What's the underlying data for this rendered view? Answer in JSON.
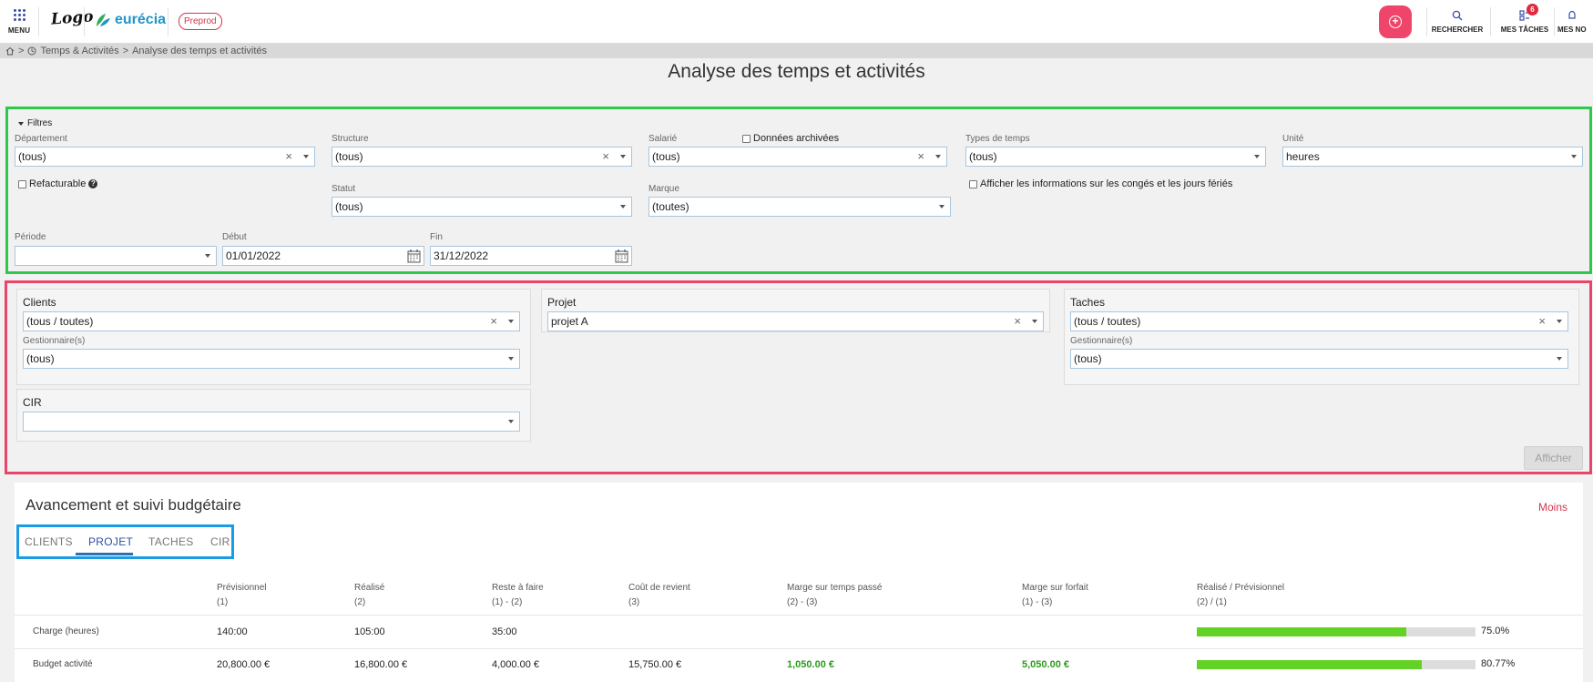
{
  "topbar": {
    "menu_label": "MENU",
    "logo_text": "Logo",
    "brand": "eurécia",
    "env_badge": "Preprod",
    "search_label": "RECHERCHER",
    "tasks_label": "MES TÂCHES",
    "tasks_count": "6",
    "notif_label": "MES NO",
    "accent_color": "#f0456a"
  },
  "breadcrumb": {
    "items": [
      "Temps & Activités",
      "Analyse des temps et activités"
    ],
    "separator": ">"
  },
  "page_title": "Analyse des temps et activités",
  "filters": {
    "toggle_label": "Filtres",
    "departement": {
      "label": "Département",
      "value": "(tous)"
    },
    "structure": {
      "label": "Structure",
      "value": "(tous)"
    },
    "salarie": {
      "label": "Salarié",
      "value": "(tous)"
    },
    "donnees_archivees": "Données archivées",
    "types_de_temps": {
      "label": "Types de temps",
      "value": "(tous)"
    },
    "unite": {
      "label": "Unité",
      "value": "heures"
    },
    "refacturable": "Refacturable",
    "statut": {
      "label": "Statut",
      "value": "(tous)"
    },
    "marque": {
      "label": "Marque",
      "value": "(toutes)"
    },
    "conges_info": "Afficher les informations sur les congés et les jours fériés",
    "periode": {
      "label": "Période",
      "value": ""
    },
    "debut": {
      "label": "Début",
      "value": "01/01/2022"
    },
    "fin": {
      "label": "Fin",
      "value": "31/12/2022"
    }
  },
  "selection": {
    "clients": {
      "title": "Clients",
      "value": "(tous / toutes)",
      "gest_label": "Gestionnaire(s)",
      "gest_value": "(tous)"
    },
    "cir": {
      "title": "CIR",
      "value": ""
    },
    "projet": {
      "title": "Projet",
      "value": "projet A"
    },
    "taches": {
      "title": "Taches",
      "value": "(tous / toutes)",
      "gest_label": "Gestionnaire(s)",
      "gest_value": "(tous)"
    },
    "afficher": "Afficher"
  },
  "budget": {
    "title": "Avancement et suivi budgétaire",
    "moins": "Moins",
    "tabs": [
      "CLIENTS",
      "PROJET",
      "TACHES",
      "CIR"
    ],
    "active_tab": "PROJET",
    "headers": [
      {
        "name": "Prévisionnel",
        "sub": "(1)"
      },
      {
        "name": "Réalisé",
        "sub": "(2)"
      },
      {
        "name": "Reste à faire",
        "sub": "(1) - (2)"
      },
      {
        "name": "Coût de revient",
        "sub": "(3)"
      },
      {
        "name": "Marge sur temps passé",
        "sub": "(2) - (3)"
      },
      {
        "name": "Marge sur forfait",
        "sub": "(1) - (3)"
      },
      {
        "name": "Réalisé / Prévisionnel",
        "sub": "(2) / (1)"
      }
    ],
    "rows": [
      {
        "label": "Charge (heures)",
        "previsionnel": "140:00",
        "realise": "105:00",
        "reste": "35:00",
        "cout": "",
        "marge_temps": "",
        "marge_forfait": "",
        "ratio": 0.75,
        "ratio_label": "75.0%"
      },
      {
        "label": "Budget activité",
        "previsionnel": "20,800.00 €",
        "realise": "16,800.00 €",
        "reste": "4,000.00 €",
        "cout": "15,750.00 €",
        "marge_temps": "1,050.00 €",
        "marge_forfait": "5,050.00 €",
        "ratio": 0.8077,
        "ratio_label": "80.77%"
      }
    ],
    "bar_color": "#62d325",
    "margin_color": "#2f9a1f"
  }
}
